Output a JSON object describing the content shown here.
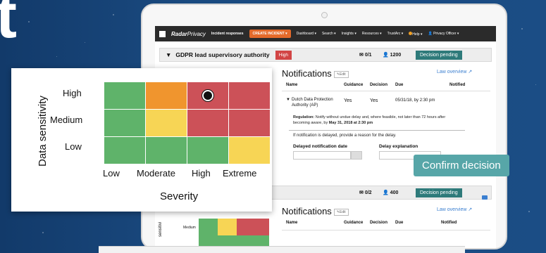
{
  "hero": {
    "letter": "t"
  },
  "nav": {
    "logo_bold": "Radar",
    "logo_light": "Privacy",
    "incident_responses": "Incident responses",
    "create": "CREATE INCIDENT",
    "items": [
      "Dashboard ▾",
      "Search ▾",
      "Insights ▾",
      "Resources ▾",
      "TrustArc ▾",
      "Help ▾",
      "Privacy Officer ▾"
    ]
  },
  "top_panel": {
    "title": "GDPR lead supervisory authority",
    "badge": "High",
    "envelope_count": "0/1",
    "people_count": "1200",
    "status": "Decision pending"
  },
  "notifications": {
    "title": "Notifications",
    "edit": "✎Edit",
    "law_overview": "Law overview",
    "headers": [
      "Name",
      "Guidance",
      "Decision",
      "Due",
      "Notified"
    ],
    "row": {
      "name_line1": "Dutch Data Protection",
      "name_line2": "Authority (AP)",
      "guidance": "Yes",
      "decision": "Yes",
      "due": "05/31/18, by 2:30 pm"
    },
    "regulation_label": "Regulation:",
    "regulation_text1": "Notify without undue delay and, where feasible, not later",
    "regulation_text2": "than 72 hours after becoming aware, by",
    "regulation_deadline": "May 31, 2018 at 2:30 pm",
    "delay_note": "If notification is delayed, provide a reason for the delay.",
    "delayed_date_label": "Delayed notification date",
    "delay_explanation_label": "Delay explanation"
  },
  "confirm_button": "Confirm decision",
  "second_panel": {
    "envelope_count": "0/2",
    "people_count": "400",
    "status": "Decision pending",
    "notif_title": "Notifications",
    "edit": "✎Edit",
    "law_overview": "Law overview",
    "headers": [
      "Name",
      "Guidance",
      "Decision",
      "Due",
      "Notified"
    ],
    "side_label": "sensitivi",
    "row_label": "Medium"
  },
  "matrix": {
    "y_title": "Data sensitivity",
    "x_title": "Severity",
    "rows": [
      "High",
      "Medium",
      "Low"
    ],
    "cols": [
      "Low",
      "Moderate",
      "High",
      "Extreme"
    ],
    "colors": {
      "green": "#5fb36a",
      "orange": "#f0952e",
      "yellow": "#f7d555",
      "red": "#cc5158"
    },
    "grid": [
      [
        "green",
        "orange",
        "red",
        "red"
      ],
      [
        "green",
        "yellow",
        "red",
        "red"
      ],
      [
        "green",
        "green",
        "green",
        "yellow"
      ]
    ],
    "selected": {
      "row": "High",
      "col": "High"
    }
  }
}
